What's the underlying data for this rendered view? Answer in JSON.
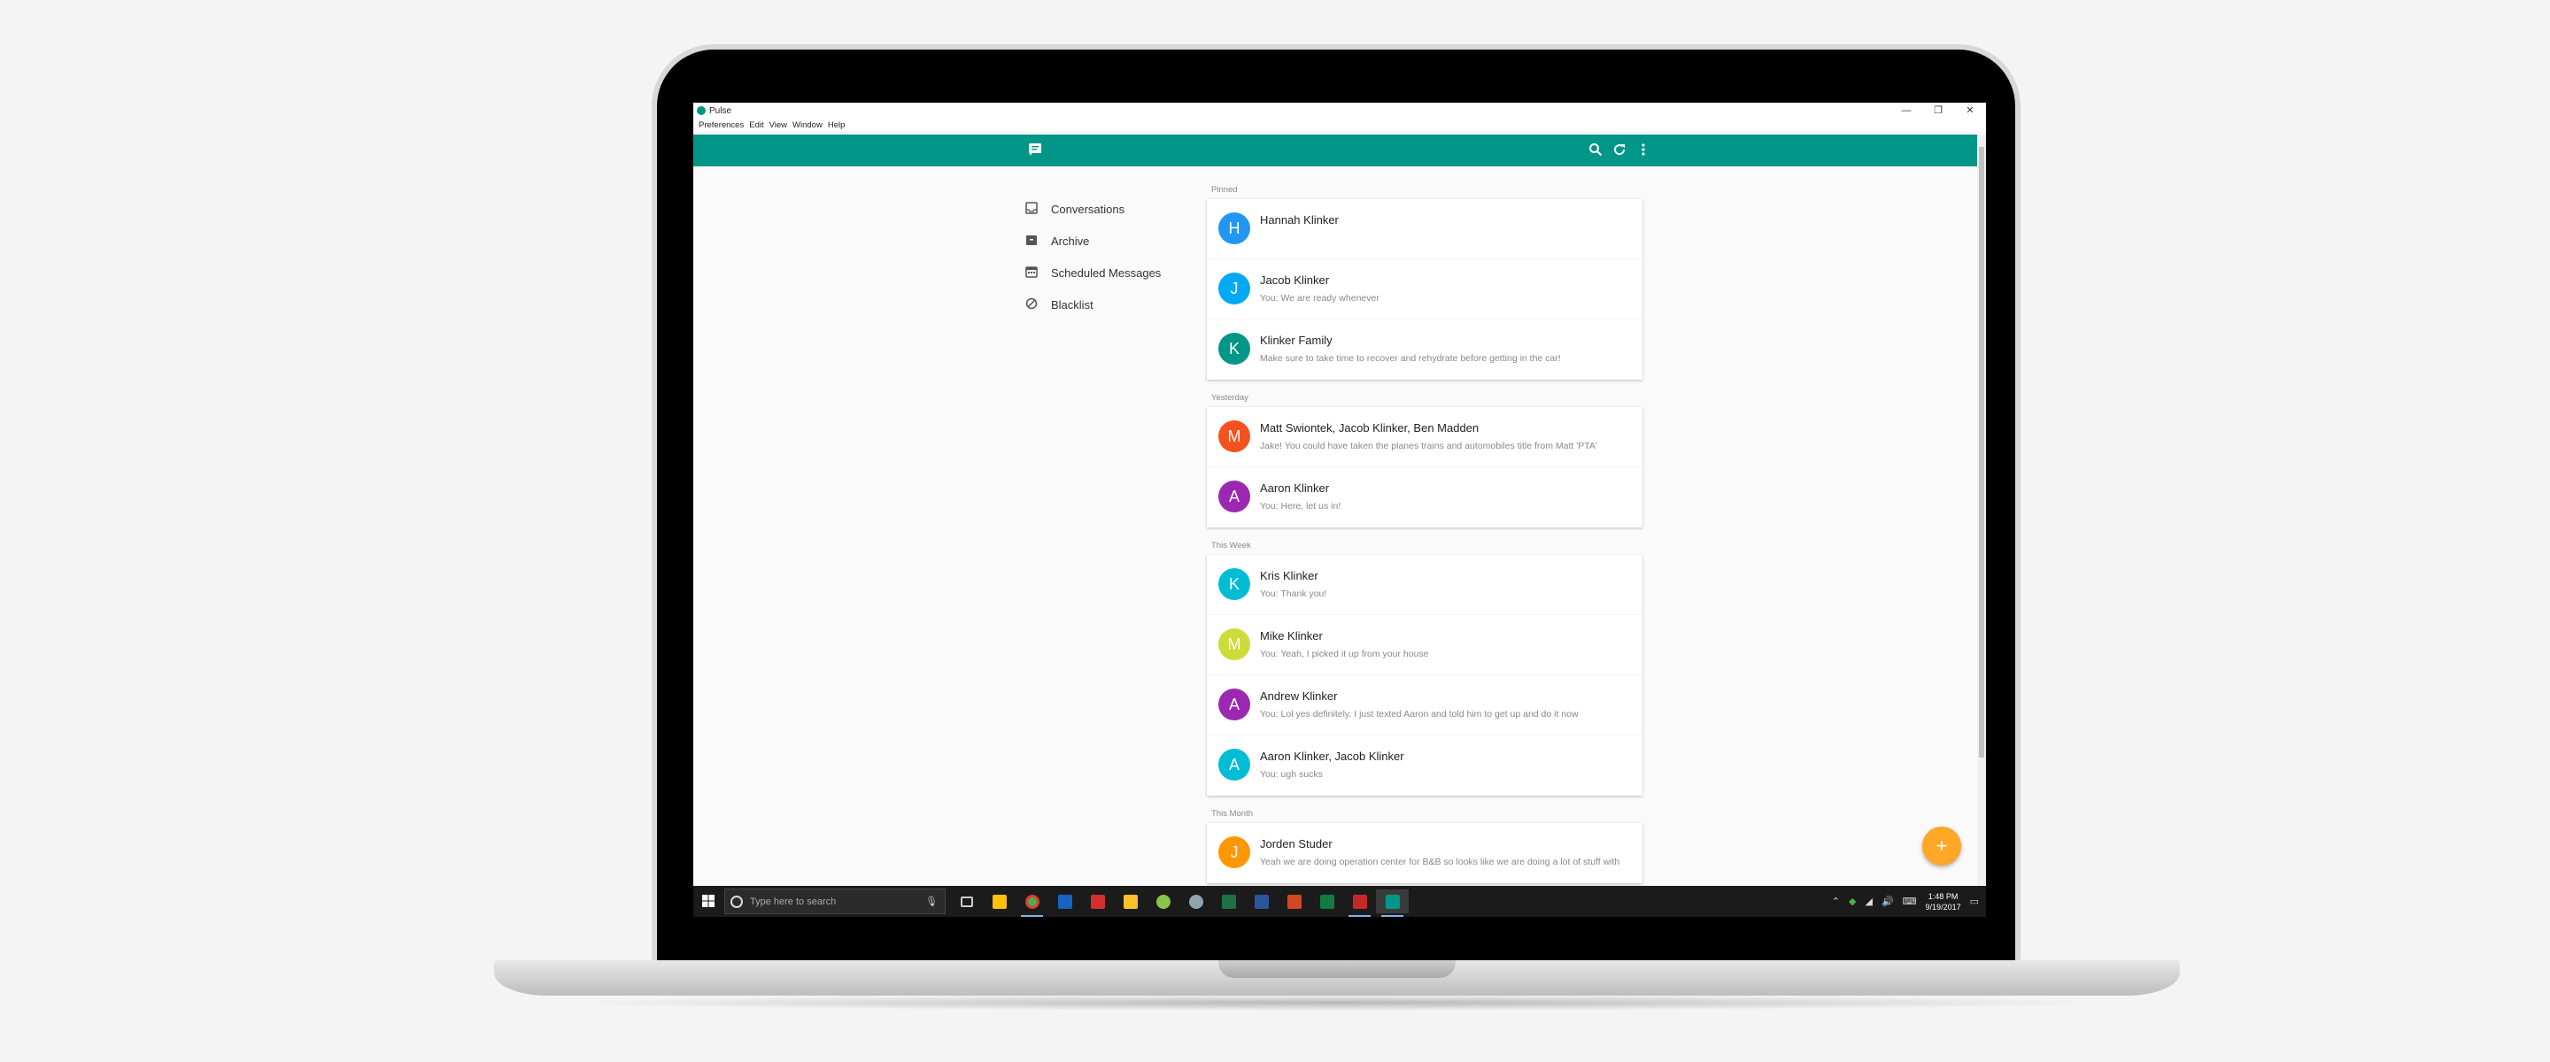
{
  "window": {
    "title": "Pulse",
    "controls": {
      "minimize": "—",
      "restore": "❐",
      "close": "✕"
    }
  },
  "menu": [
    "Preferences",
    "Edit",
    "View",
    "Window",
    "Help"
  ],
  "toolbar": {
    "logo_icon": "message-icon",
    "search_icon": "search-icon",
    "refresh_icon": "refresh-icon",
    "more_icon": "more-vert-icon",
    "color": "#009688"
  },
  "drawer": [
    {
      "label": "Conversations",
      "icon": "inbox-icon"
    },
    {
      "label": "Archive",
      "icon": "archive-icon"
    },
    {
      "label": "Scheduled Messages",
      "icon": "calendar-icon"
    },
    {
      "label": "Blacklist",
      "icon": "block-icon"
    }
  ],
  "sections": [
    {
      "label": "Pinned",
      "items": [
        {
          "initial": "H",
          "name": "Hannah Klinker",
          "snippet": "",
          "color": "#2196f3"
        },
        {
          "initial": "J",
          "name": "Jacob Klinker",
          "snippet": "You: We are ready whenever",
          "color": "#03a9f4"
        },
        {
          "initial": "K",
          "name": "Klinker Family",
          "snippet": "Make sure to take time to recover and rehydrate before getting in the car!",
          "color": "#009688"
        }
      ]
    },
    {
      "label": "Yesterday",
      "items": [
        {
          "initial": "M",
          "name": "Matt Swiontek, Jacob Klinker, Ben Madden",
          "snippet": "Jake! You could have taken the planes trains and automobiles title from Matt 'PTA'",
          "color": "#f4511e"
        },
        {
          "initial": "A",
          "name": "Aaron Klinker",
          "snippet": "You: Here, let us in!",
          "color": "#9c27b0"
        }
      ]
    },
    {
      "label": "This Week",
      "items": [
        {
          "initial": "K",
          "name": "Kris Klinker",
          "snippet": "You: Thank you!",
          "color": "#00bcd4"
        },
        {
          "initial": "M",
          "name": "Mike Klinker",
          "snippet": "You: Yeah, I picked it up from your house",
          "color": "#cddc39"
        },
        {
          "initial": "A",
          "name": "Andrew Klinker",
          "snippet": "You: Lol yes definitely. I just texted Aaron and told him to get up and do it now",
          "color": "#9c27b0"
        },
        {
          "initial": "A",
          "name": "Aaron Klinker, Jacob Klinker",
          "snippet": "You: ugh sucks",
          "color": "#00bcd4"
        }
      ]
    },
    {
      "label": "This Month",
      "items": [
        {
          "initial": "J",
          "name": "Jorden Studer",
          "snippet": "Yeah we are doing operation center for B&B so looks like we are doing a lot of stuff with",
          "color": "#ff9800"
        }
      ]
    }
  ],
  "fab": {
    "label": "+",
    "color": "#ffa726"
  },
  "taskbar": {
    "search_placeholder": "Type here to search",
    "time": "1:48 PM",
    "date": "9/19/2017",
    "apps": [
      "#ffc107",
      "#4caf50",
      "#1565c0",
      "#d32f2f",
      "#fbc02d",
      "#8bc34a",
      "#607d8b",
      "#1e7145",
      "#2b579a",
      "#d24726",
      "#107c41",
      "#c62828",
      "#009688"
    ]
  }
}
